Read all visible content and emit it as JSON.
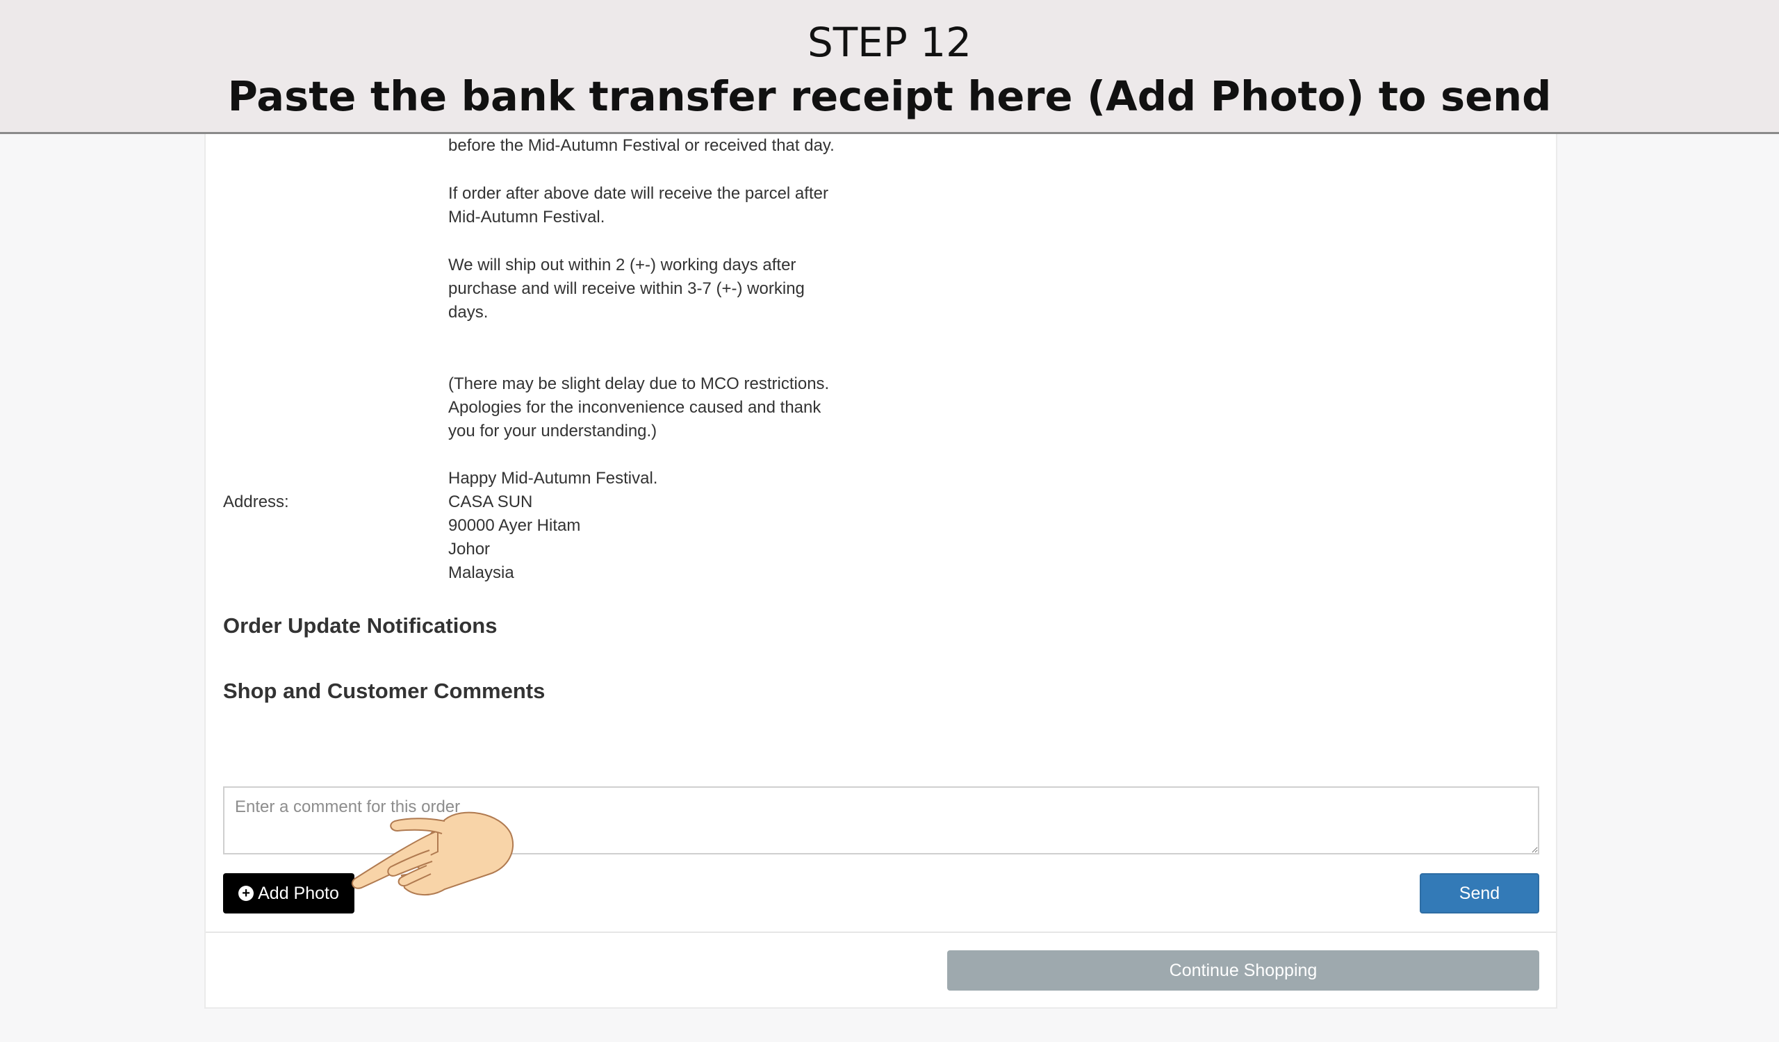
{
  "banner": {
    "step": "STEP 12",
    "instruction": "Paste the bank transfer receipt here (Add Photo) to send"
  },
  "order_note": {
    "paragraphs": [
      [
        "before the Mid-Autumn Festival or received that day."
      ],
      [
        "If order after above date will receive the parcel after",
        "Mid-Autumn Festival."
      ],
      [
        "We will ship out within 2 (+-) working days after",
        "purchase and will receive within 3-7 (+-) working",
        "days."
      ],
      [
        "(There may be slight delay due to MCO restrictions.",
        "Apologies for the inconvenience caused and thank",
        "you for your understanding.)"
      ]
    ]
  },
  "address": {
    "label": "Address:",
    "lines": [
      "Happy Mid-Autumn Festival.",
      "CASA SUN",
      "90000 Ayer Hitam",
      "Johor",
      "Malaysia"
    ]
  },
  "sections": {
    "notifications_title": "Order Update Notifications",
    "comments_title": "Shop and Customer Comments"
  },
  "comment": {
    "placeholder": "Enter a comment for this order",
    "value": ""
  },
  "buttons": {
    "add_photo": "Add Photo",
    "add_photo_icon": "plus-circle-icon",
    "send": "Send",
    "continue": "Continue Shopping"
  },
  "colors": {
    "banner_bg": "#ede9ea",
    "send_bg": "#337ab7",
    "add_photo_bg": "#000000",
    "continue_bg": "#9ea9ae"
  }
}
